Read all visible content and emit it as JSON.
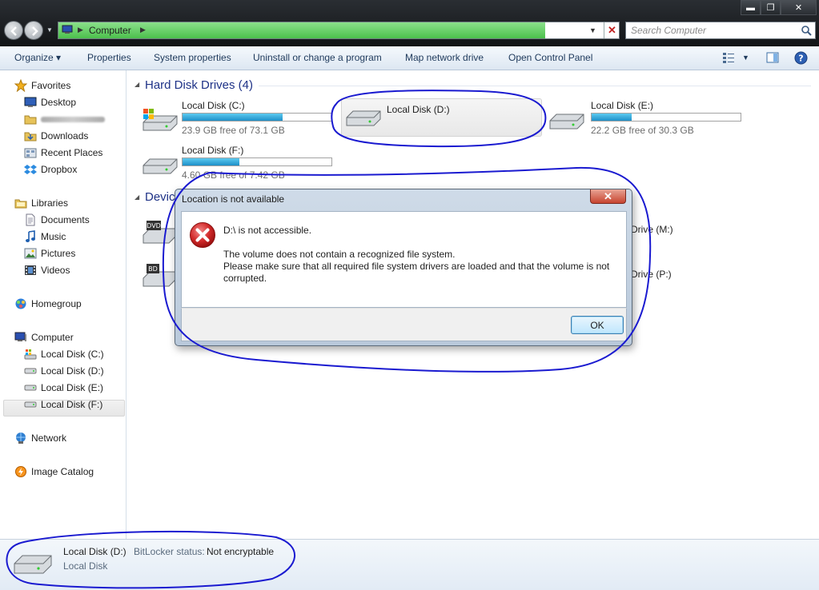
{
  "window": {
    "minimize_glyph": "▬",
    "maximize_glyph": "❐",
    "close_glyph": "✕"
  },
  "address": {
    "path": "Computer",
    "stop_glyph": "✕"
  },
  "search": {
    "placeholder": "Search Computer"
  },
  "toolbar": {
    "organize": "Organize ▾",
    "properties": "Properties",
    "system_properties": "System properties",
    "uninstall": "Uninstall or change a program",
    "map_drive": "Map network drive",
    "control_panel": "Open Control Panel",
    "view_drop": "▼"
  },
  "nav": {
    "favorites": "Favorites",
    "desktop": "Desktop",
    "downloads": "Downloads",
    "recent_places": "Recent Places",
    "dropbox": "Dropbox",
    "libraries": "Libraries",
    "documents": "Documents",
    "music": "Music",
    "pictures": "Pictures",
    "videos": "Videos",
    "homegroup": "Homegroup",
    "computer": "Computer",
    "drive_c": "Local Disk (C:)",
    "drive_d": "Local Disk (D:)",
    "drive_e": "Local Disk (E:)",
    "drive_f": "Local Disk (F:)",
    "network": "Network",
    "image_catalog": "Image Catalog"
  },
  "content": {
    "hdd_group": "Hard Disk Drives (4)",
    "devices_group_partial": "Devic",
    "drives": [
      {
        "name": "Local Disk (C:)",
        "free": "23.9 GB free of 73.1 GB",
        "used_fraction": 0.67
      },
      {
        "name": "Local Disk (D:)"
      },
      {
        "name": "Local Disk (E:)",
        "free": "22.2 GB free of 30.3 GB",
        "used_fraction": 0.27
      },
      {
        "name": "Local Disk (F:)",
        "free": "4.60 GB free of 7.42 GB",
        "used_fraction": 0.38
      }
    ],
    "drive_m_partial": "Drive (M:)",
    "drive_p_partial": "Drive (P:)",
    "dvd_label": "DVD",
    "bd_label": "BD"
  },
  "dialog": {
    "title": "Location is not available",
    "close_glyph": "✕",
    "main": "D:\\ is not accessible.",
    "detail1": "The volume does not contain a recognized file system.",
    "detail2": "Please make sure that all required file system drivers are loaded and that the volume is not corrupted.",
    "ok": "OK"
  },
  "details": {
    "name": "Local Disk (D:)",
    "bitlocker_key": "BitLocker status:",
    "bitlocker_value": "Not encryptable",
    "type": "Local Disk"
  },
  "colors": {
    "address_fill": "#4cc04c",
    "group_heading": "#1e3287",
    "annotation": "#1a1ad0",
    "error": "#d02020"
  }
}
